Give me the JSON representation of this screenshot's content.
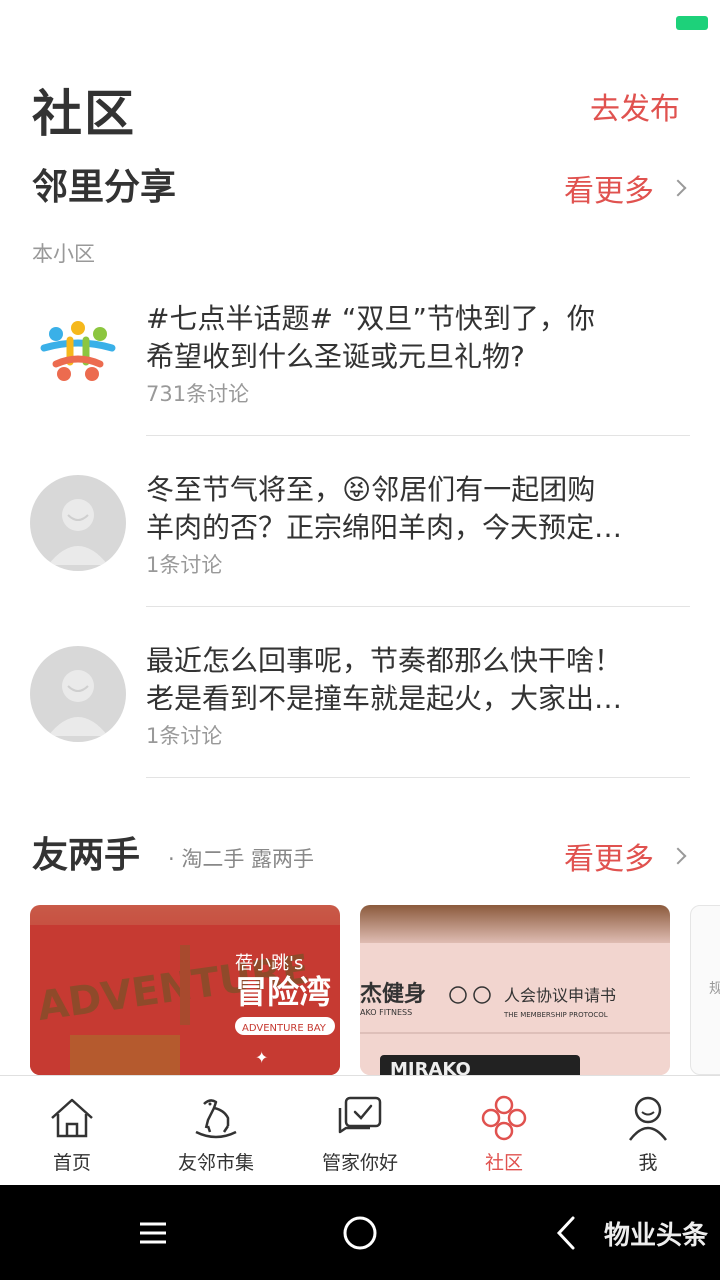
{
  "header": {
    "title": "社区",
    "publish_label": "去发布"
  },
  "neighbor_share": {
    "title": "邻里分享",
    "more_label": "看更多",
    "scope_label": "本小区",
    "posts": [
      {
        "line1": "#七点半话题# “双旦”节快到了，你",
        "line2": "希望收到什么圣诞或元旦礼物?",
        "count": "731条讨论",
        "avatar": "colorful-people-logo-icon"
      },
      {
        "line1": "冬至节气将至，😝邻居们有一起团购",
        "line2": "羊肉的否？正宗绵阳羊肉，今天预定…",
        "count": "1条讨论",
        "avatar": "default-avatar-icon"
      },
      {
        "line1": "最近怎么回事呢，节奏都那么快干啥！",
        "line2": "老是看到不是撞车就是起火，大家出…",
        "count": "1条讨论",
        "avatar": "default-avatar-icon"
      }
    ]
  },
  "second_hand": {
    "title": "友两手",
    "subtitle": "· 淘二手 露两手",
    "more_label": "看更多",
    "cards": [
      {
        "brand": "蓓小跳's",
        "name": "冒险湾",
        "english": "ADVENTURE BAY",
        "bg_text": "ADVENTURE"
      },
      {
        "brand": "杰健身",
        "brand_en": "AKO FITNESS",
        "doc_title": "人会协议申请书",
        "doc_en": "THE MEMBERSHIP PROTOCOL",
        "card_text": "MIRAKO"
      },
      {
        "snippet": "规"
      }
    ]
  },
  "tabs": [
    {
      "label": "首页",
      "icon": "home-icon",
      "active": false
    },
    {
      "label": "友邻市集",
      "icon": "rocking-horse-icon",
      "active": false
    },
    {
      "label": "管家你好",
      "icon": "chat-check-icon",
      "active": false
    },
    {
      "label": "社区",
      "icon": "community-knot-icon",
      "active": true
    },
    {
      "label": "我",
      "icon": "user-icon",
      "active": false
    }
  ],
  "watermark": "物业头条",
  "colors": {
    "accent": "#e0524f",
    "battery": "#1dd17a",
    "text": "#333333",
    "muted": "#999999"
  }
}
